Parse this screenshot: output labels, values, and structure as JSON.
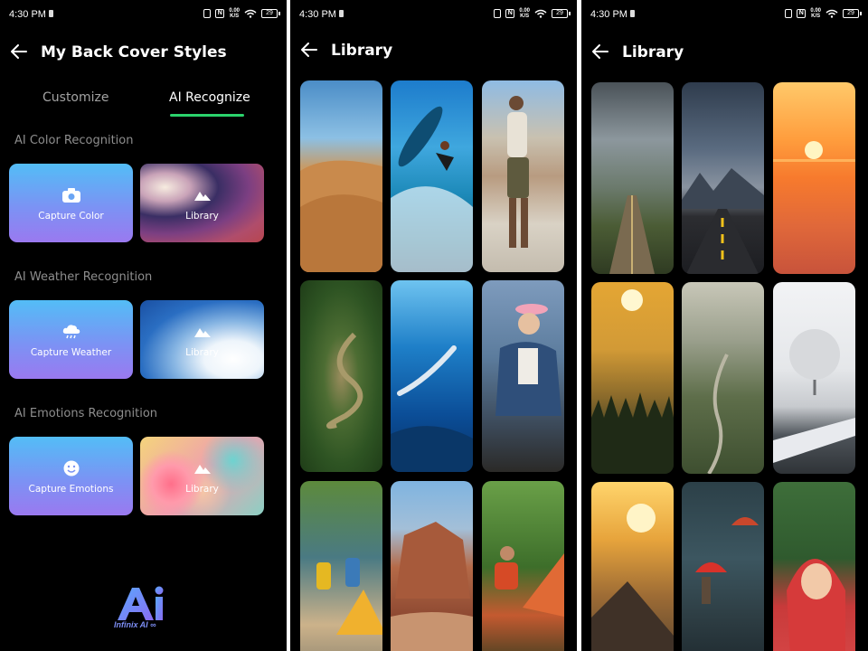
{
  "status_bar": {
    "time": "4:30 PM",
    "speed_top": "0.00",
    "speed_bottom": "K/S",
    "battery": "29"
  },
  "screen1": {
    "title": "My Back Cover Styles",
    "tabs": [
      "Customize",
      "AI Recognize"
    ],
    "active_tab": "AI Recognize",
    "sections": [
      {
        "title": "AI Color Recognition",
        "capture_label": "Capture Color",
        "library_label": "Library"
      },
      {
        "title": "AI Weather Recognition",
        "capture_label": "Capture Weather",
        "library_label": "Library"
      },
      {
        "title": "AI Emotions Recognition",
        "capture_label": "Capture Emotions",
        "library_label": "Library"
      }
    ],
    "brand_text": "Infinix AI ∞",
    "accent_color": "#2bd36c"
  },
  "screen2": {
    "title": "Library",
    "images": [
      "desert",
      "surfer",
      "walker",
      "river",
      "diver",
      "hiker",
      "campers",
      "rock",
      "tent"
    ]
  },
  "screen3": {
    "title": "Library",
    "images": [
      "storm-road",
      "mountain-road",
      "sea-sunset",
      "misty-forest",
      "foggy-valley",
      "snow-tree",
      "sun-mountain",
      "umbrella-rain",
      "red-raincoat"
    ]
  }
}
